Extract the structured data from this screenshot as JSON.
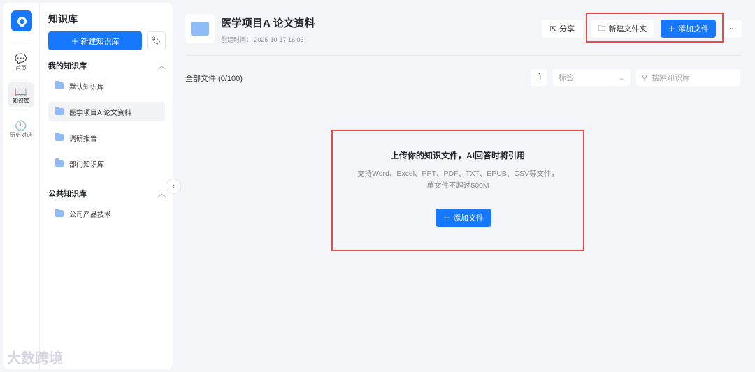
{
  "rail": {
    "items": [
      {
        "label": "首页",
        "icon": "chat-icon"
      },
      {
        "label": "知识库",
        "icon": "book-icon"
      },
      {
        "label": "历史对话",
        "icon": "clock-icon"
      }
    ]
  },
  "library": {
    "title": "知识库",
    "new_button": "新建知识库",
    "my_section": "我的知识库",
    "my_items": [
      "默认知识库",
      "医学项目A 论文资料",
      "调研报告",
      "部门知识库"
    ],
    "public_section": "公共知识库",
    "public_items": [
      "公司产品技术"
    ]
  },
  "header": {
    "title": "医学项目A 论文资料",
    "created": "创建时间： 2025-10-17 16:03",
    "share": "分享",
    "new_folder": "新建文件夹",
    "add_file": "添加文件",
    "more": "···"
  },
  "toolbar": {
    "all_files": "全部文件  (0/100)",
    "tag_placeholder": "标签",
    "search_placeholder": "搜索知识库"
  },
  "empty": {
    "title": "上传你的知识文件，AI回答时将引用",
    "line1": "支持Word、Excel、PPT、PDF、TXT、EPUB、CSV等文件，",
    "line2": "单文件不超过500M",
    "button": "添加文件"
  },
  "watermark": "大数跨境",
  "colors": {
    "primary": "#1677ff",
    "highlight": "#e84a4a"
  }
}
